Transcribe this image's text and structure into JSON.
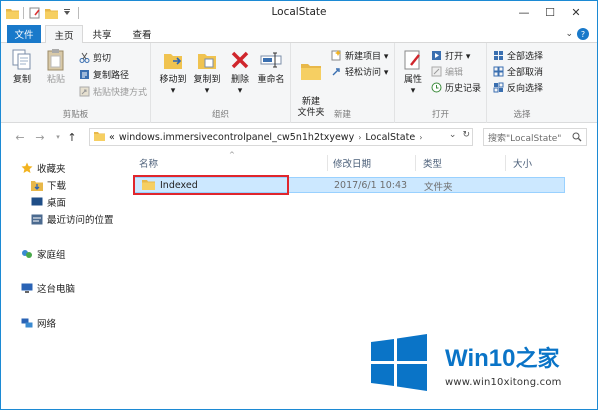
{
  "window": {
    "title": "LocalState",
    "minimize": "—",
    "maximize": "☐",
    "close": "✕"
  },
  "ribbon_tabs": {
    "file": "文件",
    "home": "主页",
    "share": "共享",
    "view": "查看"
  },
  "ribbon": {
    "clipboard": {
      "label": "剪贴板",
      "copy": "复制",
      "paste": "粘贴",
      "cut": "剪切",
      "copy_path": "复制路径",
      "paste_shortcut": "粘贴快捷方式"
    },
    "organize": {
      "label": "组织",
      "move_to": "移动到",
      "copy_to": "复制到",
      "delete": "删除",
      "rename": "重命名"
    },
    "new": {
      "label": "新建",
      "new_folder": "新建\n文件夹",
      "new_item": "新建项目 ▾",
      "easy_access": "轻松访问 ▾"
    },
    "open": {
      "label": "打开",
      "properties": "属性",
      "open": "打开 ▾",
      "edit": "编辑",
      "history": "历史记录"
    },
    "select": {
      "label": "选择",
      "select_all": "全部选择",
      "select_none": "全部取消",
      "invert": "反向选择"
    }
  },
  "address": {
    "back": "←",
    "forward": "→",
    "up": "↑",
    "prefix": "«",
    "segment1": "windows.immersivecontrolpanel_cw5n1h2txyewy",
    "segment2": "LocalState",
    "search_placeholder": "搜索\"LocalState\""
  },
  "nav": {
    "favorites": "收藏夹",
    "downloads": "下载",
    "desktop": "桌面",
    "recent": "最近访问的位置",
    "homegroup": "家庭组",
    "this_pc": "这台电脑",
    "network": "网络"
  },
  "columns": {
    "name": "名称",
    "date": "修改日期",
    "type": "类型",
    "size": "大小"
  },
  "files": [
    {
      "name": "Indexed",
      "date": "2017/6/1 10:43",
      "type": "文件夹"
    }
  ],
  "watermark": {
    "brand": "Win10",
    "brand_zh": "之家",
    "url": "www.win10xitong.com"
  }
}
